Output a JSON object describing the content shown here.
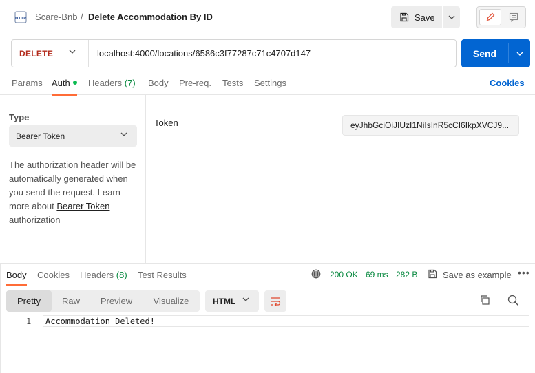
{
  "header": {
    "collection": "Scare-Bnb",
    "separator": "/",
    "request_name": "Delete Accommodation By ID",
    "save_label": "Save"
  },
  "request": {
    "method": "DELETE",
    "method_color": "#b32c1e",
    "url": "localhost:4000/locations/6586c3f77287c71c4707d147",
    "send_label": "Send"
  },
  "request_tabs": {
    "params": "Params",
    "auth": "Auth",
    "headers": "Headers",
    "headers_count": "(7)",
    "body": "Body",
    "prereq": "Pre-req.",
    "tests": "Tests",
    "settings": "Settings",
    "cookies": "Cookies"
  },
  "auth": {
    "type_label": "Type",
    "type_value": "Bearer Token",
    "desc_part1": "The authorization header will be automatically generated when you send the request. Learn more about ",
    "desc_link": "Bearer Token",
    "desc_part2": " authorization",
    "token_label": "Token",
    "token_value": "eyJhbGciOiJIUzI1NiIsInR5cCI6IkpXVCJ9..."
  },
  "response": {
    "tabs": {
      "body": "Body",
      "cookies": "Cookies",
      "headers": "Headers",
      "headers_count": "(8)",
      "test_results": "Test Results"
    },
    "status": "200 OK",
    "time": "69 ms",
    "size": "282 B",
    "save_example": "Save as example",
    "status_color": "#0a8a41",
    "views": [
      "Pretty",
      "Raw",
      "Preview",
      "Visualize"
    ],
    "active_view": "Pretty",
    "language": "HTML",
    "lines": [
      {
        "no": "1",
        "text": "Accommodation Deleted!"
      }
    ]
  },
  "colors": {
    "accent": "#ff6c37",
    "primary": "#0265d2"
  }
}
